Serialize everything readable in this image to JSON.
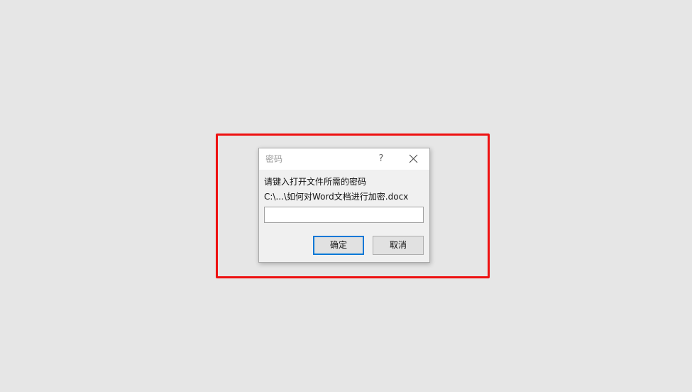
{
  "dialog": {
    "title": "密码",
    "help_label": "?",
    "prompt": "请键入打开文件所需的密码",
    "file_path": "C:\\...\\如何对Word文档进行加密.docx",
    "password_value": "",
    "ok_label": "确定",
    "cancel_label": "取消"
  },
  "colors": {
    "background": "#e6e6e6",
    "highlight_border": "#ee1111",
    "default_button_border": "#0078d7"
  }
}
